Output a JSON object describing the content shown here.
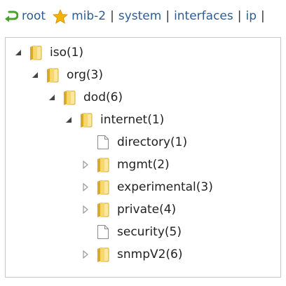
{
  "breadcrumb": {
    "items": [
      {
        "label": "root",
        "icon": "return-arrow-icon",
        "color": "#4aa02c"
      },
      {
        "label": "mib-2",
        "icon": "star-icon",
        "color": "#f3b400"
      },
      {
        "label": "system"
      },
      {
        "label": "interfaces"
      },
      {
        "label": "ip"
      }
    ],
    "separator": "|"
  },
  "tree": {
    "nodes": [
      {
        "label": "iso(1)",
        "type": "folder",
        "state": "expanded"
      },
      {
        "label": "org(3)",
        "type": "folder",
        "state": "expanded"
      },
      {
        "label": "dod(6)",
        "type": "folder",
        "state": "expanded"
      },
      {
        "label": "internet(1)",
        "type": "folder",
        "state": "expanded"
      },
      {
        "label": "directory(1)",
        "type": "document",
        "state": "leaf"
      },
      {
        "label": "mgmt(2)",
        "type": "folder",
        "state": "collapsed"
      },
      {
        "label": "experimental(3)",
        "type": "folder",
        "state": "collapsed"
      },
      {
        "label": "private(4)",
        "type": "folder",
        "state": "collapsed"
      },
      {
        "label": "security(5)",
        "type": "document",
        "state": "leaf"
      },
      {
        "label": "snmpV2(6)",
        "type": "folder",
        "state": "collapsed"
      }
    ]
  },
  "colors": {
    "link": "#2c5d93",
    "folder_light": "#fbe9a1",
    "folder_dark": "#d9a92a",
    "toggle_expanded": "#444444",
    "toggle_collapsed": "#9a9a9a"
  }
}
